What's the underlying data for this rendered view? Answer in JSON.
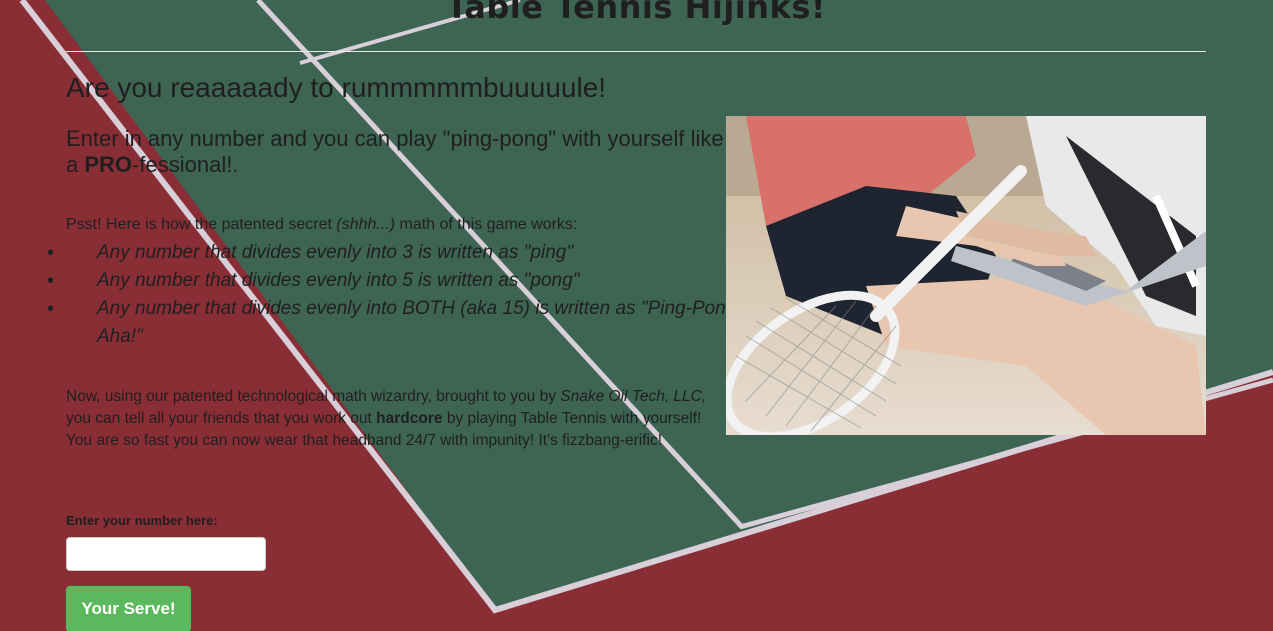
{
  "colors": {
    "court_green": "#3e6554",
    "court_red": "#8a2e36",
    "court_lines": "#d8cfd9",
    "button_green": "#5cb85c"
  },
  "header": {
    "title": "Table Tennis Hijinks!"
  },
  "main": {
    "headline": "Are you reaaaaady to rummmmmbuuuuule!",
    "subhead_before": "Enter in any number and you can play \"ping-pong\" with yourself like a ",
    "subhead_bold": "PRO",
    "subhead_after": "-fessional!.",
    "psst_before": "Psst! Here is how the patented secret ",
    "psst_italic": "(shhh...)",
    "psst_after": " math of this game works:",
    "rules": [
      "Any number that divides evenly into 3 is written as \"ping\"",
      "Any number that divides evenly into 5 is written as \"pong\"",
      "Any number that divides evenly into BOTH (aka 15) is written as \"Ping-Pong! Aha!\""
    ],
    "story_1": "Now, using our patented technological math wizardry, brought to you by ",
    "story_company": "Snake Oil Tech, LLC,",
    "story_2": " you can tell all your friends that you work out ",
    "story_bold": "hardcore",
    "story_3": " by playing Table Tennis with yourself! You are so fast you can now wear that headband 24/7 with impunity! It's fizzbang-erific!"
  },
  "photo": {
    "icon": "tennis-player-laptop-photo"
  },
  "form": {
    "label": "Enter your number here:",
    "value": "",
    "button_label": "Your Serve!"
  }
}
